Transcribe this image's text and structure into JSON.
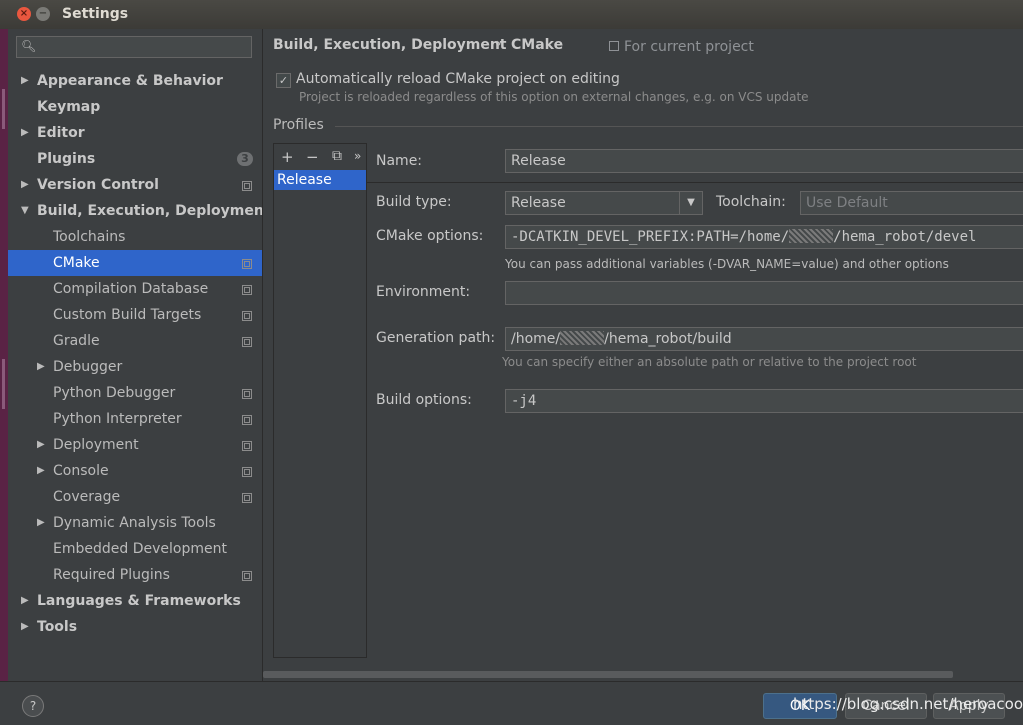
{
  "window": {
    "title": "Settings",
    "close_glyph": "×",
    "min_glyph": "−"
  },
  "search": {
    "placeholder": "",
    "icon": "search-icon",
    "glyph": "🔍︎"
  },
  "nav": {
    "items": [
      {
        "label": "Appearance & Behavior",
        "expandable": true,
        "expanded": false
      },
      {
        "label": "Keymap"
      },
      {
        "label": "Editor",
        "expandable": true,
        "expanded": false
      },
      {
        "label": "Plugins",
        "badge": "3"
      },
      {
        "label": "Version Control",
        "expandable": true,
        "expanded": false
      },
      {
        "label": "Build, Execution, Deployment",
        "expandable": true,
        "expanded": true
      }
    ],
    "sub_items": [
      {
        "label": "Toolchains"
      },
      {
        "label": "CMake",
        "selected": true
      },
      {
        "label": "Compilation Database"
      },
      {
        "label": "Custom Build Targets"
      },
      {
        "label": "Gradle"
      },
      {
        "label": "Debugger",
        "expandable": true
      },
      {
        "label": "Python Debugger"
      },
      {
        "label": "Python Interpreter"
      },
      {
        "label": "Deployment",
        "expandable": true
      },
      {
        "label": "Console",
        "expandable": true
      },
      {
        "label": "Coverage"
      },
      {
        "label": "Dynamic Analysis Tools",
        "expandable": true
      },
      {
        "label": "Embedded Development"
      },
      {
        "label": "Required Plugins"
      }
    ],
    "bottom_items": [
      {
        "label": "Languages & Frameworks",
        "expandable": true
      },
      {
        "label": "Tools",
        "expandable": true
      }
    ],
    "arrow_collapsed": "▶",
    "arrow_expanded": "▼"
  },
  "breadcrumb": {
    "parent": "Build, Execution, Deployment",
    "separator": "›",
    "current": "CMake",
    "scope": "For current project"
  },
  "auto_reload": {
    "checked": true,
    "check_glyph": "✓",
    "label": "Automatically reload CMake project on editing",
    "hint": "Project is reloaded regardless of this option on external changes, e.g. on VCS update"
  },
  "profiles": {
    "label": "Profiles",
    "toolbar": {
      "add": "+",
      "remove": "−",
      "copy": "⧉",
      "more": "»"
    },
    "list": [
      "Release"
    ]
  },
  "form": {
    "name_label": "Name:",
    "name_value": "Release",
    "build_type_label": "Build type:",
    "build_type_value": "Release",
    "dropdown_glyph": "▼",
    "toolchain_label": "Toolchain:",
    "toolchain_value": "Use Default",
    "cmake_options_label": "CMake options:",
    "cmake_options_prefix": "-DCATKIN_DEVEL_PREFIX:PATH=/home/",
    "cmake_options_suffix": "/hema_robot/devel",
    "cmake_options_hint": "You can pass additional variables (-DVAR_NAME=value) and other options",
    "environment_label": "Environment:",
    "environment_value": "",
    "generation_path_label": "Generation path:",
    "generation_path_prefix": "/home/",
    "generation_path_suffix": "/hema_robot/build",
    "generation_path_hint": "You can specify either an absolute path or relative to the project root",
    "build_options_label": "Build options:",
    "build_options_value": "-j4"
  },
  "footer": {
    "help": "?",
    "ok": "OK",
    "cancel": "Cancel",
    "apply": "Apply",
    "watermark": "https://blog.csdn.net/heroacool"
  },
  "colors": {
    "selection": "#2f65ca",
    "background": "#3c3f41",
    "field": "#45494a",
    "ok_button": "#365880"
  }
}
